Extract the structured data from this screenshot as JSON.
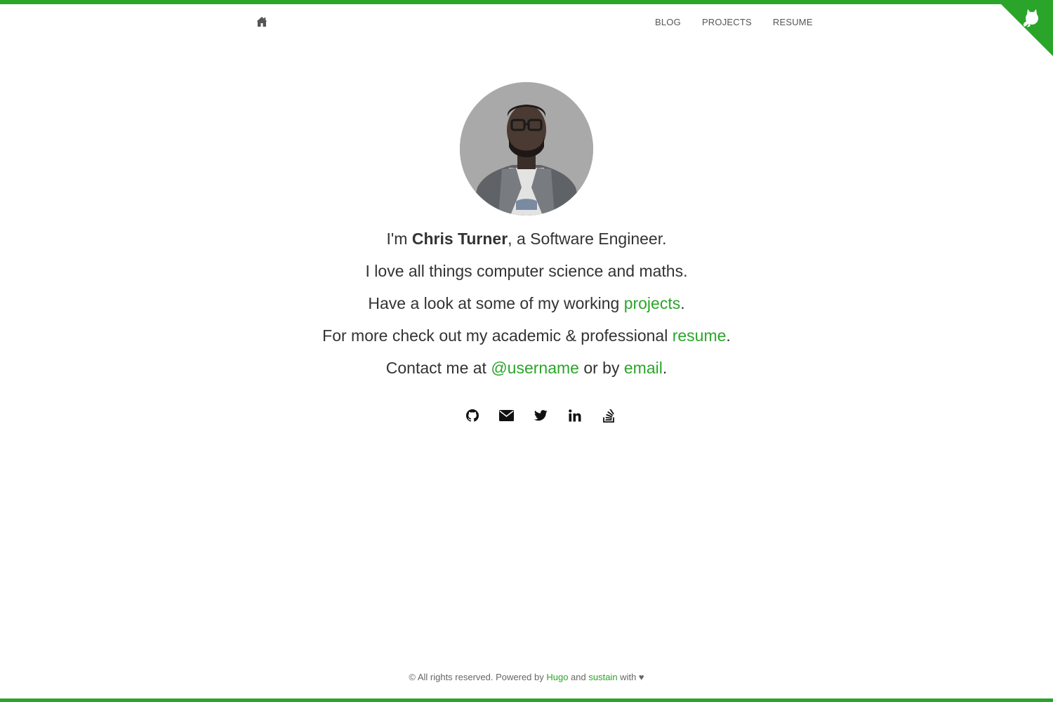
{
  "theme": {
    "accent": "#2aa52a",
    "text": "#333333",
    "muted": "#666666"
  },
  "header": {
    "home_icon": "home-icon",
    "nav": [
      {
        "label": "BLOG"
      },
      {
        "label": "PROJECTS"
      },
      {
        "label": "RESUME"
      }
    ],
    "corner_icon": "github-octocat-icon"
  },
  "intro": {
    "line1_prefix": "I'm ",
    "name": "Chris Turner",
    "line1_suffix": ", a Software Engineer.",
    "line2": "I love all things computer science and maths.",
    "line3_prefix": "Have a look at some of my working ",
    "line3_link": "projects",
    "line3_suffix": ".",
    "line4_prefix": "For more check out my academic & professional ",
    "line4_link": "resume",
    "line4_suffix": ".",
    "line5_prefix": "Contact me at ",
    "line5_handle": "@username",
    "line5_middle": " or by ",
    "line5_email": "email",
    "line5_suffix": "."
  },
  "social": [
    "github-icon",
    "envelope-icon",
    "twitter-icon",
    "linkedin-icon",
    "stackoverflow-icon"
  ],
  "footer": {
    "prefix": "© All rights reserved. Powered by ",
    "hugo": "Hugo",
    "and": " and ",
    "sustain": "sustain",
    "suffix": " with ♥"
  }
}
